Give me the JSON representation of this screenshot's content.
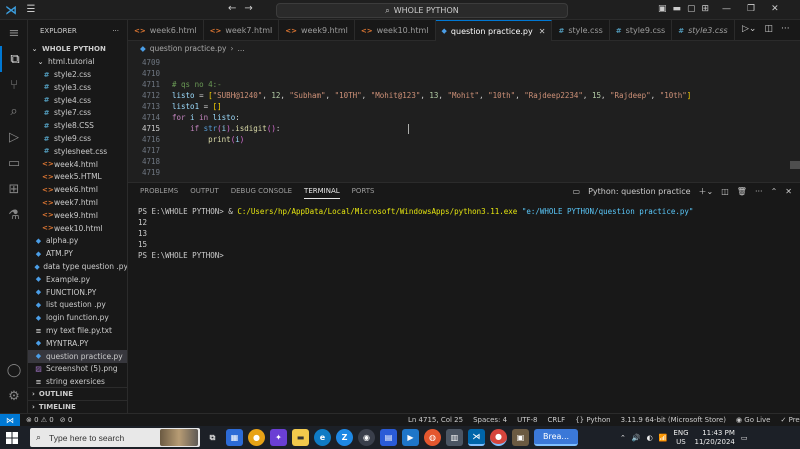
{
  "window": {
    "title": "WHOLE PYTHON"
  },
  "explorer": {
    "header": "EXPLORER",
    "root": "WHOLE PYTHON",
    "folder": "html.tutorial",
    "items": [
      {
        "name": "style2.css",
        "type": "css",
        "indent": 2
      },
      {
        "name": "style3.css",
        "type": "css",
        "indent": 2
      },
      {
        "name": "style4.css",
        "type": "css",
        "indent": 2
      },
      {
        "name": "style7.css",
        "type": "css",
        "indent": 2
      },
      {
        "name": "style8.CSS",
        "type": "css",
        "indent": 2
      },
      {
        "name": "style9.css",
        "type": "css",
        "indent": 2
      },
      {
        "name": "stylesheet.css",
        "type": "css",
        "indent": 2
      },
      {
        "name": "week4.html",
        "type": "html",
        "indent": 2
      },
      {
        "name": "week5.HTML",
        "type": "html",
        "indent": 2
      },
      {
        "name": "week6.html",
        "type": "html",
        "indent": 2
      },
      {
        "name": "week7.html",
        "type": "html",
        "indent": 2
      },
      {
        "name": "week9.html",
        "type": "html",
        "indent": 2
      },
      {
        "name": "week10.html",
        "type": "html",
        "indent": 2
      },
      {
        "name": "alpha.py",
        "type": "py",
        "indent": 1
      },
      {
        "name": "ATM.PY",
        "type": "py",
        "indent": 1
      },
      {
        "name": "data type question .py",
        "type": "py",
        "indent": 1
      },
      {
        "name": "Example.py",
        "type": "py",
        "indent": 1
      },
      {
        "name": "FUNCTION.PY",
        "type": "py",
        "indent": 1
      },
      {
        "name": "list question .py",
        "type": "py",
        "indent": 1
      },
      {
        "name": "login function.py",
        "type": "py",
        "indent": 1
      },
      {
        "name": "my text file.py.txt",
        "type": "txt",
        "indent": 1
      },
      {
        "name": "MYNTRA.PY",
        "type": "py",
        "indent": 1
      },
      {
        "name": "question practice.py",
        "type": "py",
        "indent": 1,
        "selected": true
      },
      {
        "name": "Screenshot (5).png",
        "type": "png",
        "indent": 1
      },
      {
        "name": "string exersices",
        "type": "txt",
        "indent": 1
      }
    ],
    "outline": "OUTLINE",
    "timeline": "TIMELINE"
  },
  "tabs": [
    {
      "label": "week6.html",
      "type": "html"
    },
    {
      "label": "week7.html",
      "type": "html"
    },
    {
      "label": "week9.html",
      "type": "html"
    },
    {
      "label": "week10.html",
      "type": "html"
    },
    {
      "label": "question practice.py",
      "type": "py",
      "active": true
    },
    {
      "label": "style.css",
      "type": "css"
    },
    {
      "label": "style9.css",
      "type": "css"
    },
    {
      "label": "style3.css",
      "type": "css"
    }
  ],
  "breadcrumb": {
    "file": "question practice.py",
    "rest": "..."
  },
  "editor": {
    "lines": [
      {
        "num": "4709",
        "tokens": []
      },
      {
        "num": "4710",
        "tokens": []
      },
      {
        "num": "4711",
        "tokens": [
          {
            "t": "# qs no 4:-",
            "c": "c"
          }
        ]
      },
      {
        "num": "4712",
        "tokens": [
          {
            "t": "listo",
            "c": "v"
          },
          {
            "t": " = ",
            "c": "o"
          },
          {
            "t": "[",
            "c": "b1"
          },
          {
            "t": "\"SUBH@1240\"",
            "c": "s"
          },
          {
            "t": ", ",
            "c": "o"
          },
          {
            "t": "12",
            "c": "n"
          },
          {
            "t": ", ",
            "c": "o"
          },
          {
            "t": "\"Subham\"",
            "c": "s"
          },
          {
            "t": ", ",
            "c": "o"
          },
          {
            "t": "\"10TH\"",
            "c": "s"
          },
          {
            "t": ", ",
            "c": "o"
          },
          {
            "t": "\"Mohit@123\"",
            "c": "s"
          },
          {
            "t": ", ",
            "c": "o"
          },
          {
            "t": "13",
            "c": "n"
          },
          {
            "t": ", ",
            "c": "o"
          },
          {
            "t": "\"Mohit\"",
            "c": "s"
          },
          {
            "t": ", ",
            "c": "o"
          },
          {
            "t": "\"10th\"",
            "c": "s"
          },
          {
            "t": ", ",
            "c": "o"
          },
          {
            "t": "\"Rajdeep2234\"",
            "c": "s"
          },
          {
            "t": ", ",
            "c": "o"
          },
          {
            "t": "15",
            "c": "n"
          },
          {
            "t": ", ",
            "c": "o"
          },
          {
            "t": "\"Rajdeep\"",
            "c": "s"
          },
          {
            "t": ", ",
            "c": "o"
          },
          {
            "t": "\"10th\"",
            "c": "s"
          },
          {
            "t": "]",
            "c": "b1"
          }
        ]
      },
      {
        "num": "4713",
        "tokens": [
          {
            "t": "listo1",
            "c": "v"
          },
          {
            "t": " = ",
            "c": "o"
          },
          {
            "t": "[]",
            "c": "b1"
          }
        ]
      },
      {
        "num": "4714",
        "tokens": [
          {
            "t": "for",
            "c": "kc"
          },
          {
            "t": " i ",
            "c": "v"
          },
          {
            "t": "in",
            "c": "kc"
          },
          {
            "t": " listo",
            "c": "v"
          },
          {
            "t": ":",
            "c": "o"
          }
        ]
      },
      {
        "num": "4715",
        "tokens": [
          {
            "t": "    ",
            "c": "o"
          },
          {
            "t": "if",
            "c": "kc"
          },
          {
            "t": " ",
            "c": "o"
          },
          {
            "t": "str",
            "c": "k"
          },
          {
            "t": "(",
            "c": "b2"
          },
          {
            "t": "i",
            "c": "v"
          },
          {
            "t": ")",
            "c": "b2"
          },
          {
            "t": ".",
            "c": "o"
          },
          {
            "t": "isdigit",
            "c": "f"
          },
          {
            "t": "()",
            "c": "b2"
          },
          {
            "t": ":",
            "c": "o"
          }
        ],
        "current": true
      },
      {
        "num": "4716",
        "tokens": [
          {
            "t": "        ",
            "c": "o"
          },
          {
            "t": "print",
            "c": "f"
          },
          {
            "t": "(",
            "c": "b2"
          },
          {
            "t": "i",
            "c": "v"
          },
          {
            "t": ")",
            "c": "b2"
          }
        ]
      },
      {
        "num": "4717",
        "tokens": []
      },
      {
        "num": "4718",
        "tokens": []
      },
      {
        "num": "4719",
        "tokens": []
      }
    ]
  },
  "panel": {
    "tabs": [
      "PROBLEMS",
      "OUTPUT",
      "DEBUG CONSOLE",
      "TERMINAL",
      "PORTS"
    ],
    "active_tab": "TERMINAL",
    "terminal_name": "Python: question practice",
    "terminal": {
      "prompt": "PS E:\\WHOLE PYTHON> & ",
      "exe": "C:/Users/hp/AppData/Local/Microsoft/WindowsApps/python3.11.exe",
      "arg": "\"e:/WHOLE PYTHON/question practice.py\"",
      "output": [
        "12",
        "13",
        "15"
      ],
      "final_prompt": "PS E:\\WHOLE PYTHON> "
    }
  },
  "statusbar": {
    "errors": "0",
    "warnings": "0",
    "ports": "0",
    "position": "Ln 4715, Col 25",
    "spaces": "Spaces: 4",
    "encoding": "UTF-8",
    "eol": "CRLF",
    "language": "Python",
    "interpreter": "3.11.9 64-bit (Microsoft Store)",
    "golive": "Go Live",
    "prettier": "Prettier"
  },
  "taskbar": {
    "search_placeholder": "Type here to search",
    "running_label": "Brea...",
    "lang1": "ENG",
    "lang2": "US",
    "time": "11:43 PM",
    "date": "11/20/2024"
  },
  "colors": {
    "accent": "#0078d4",
    "editor_bg": "#1f1f1f",
    "sidebar_bg": "#181818"
  }
}
